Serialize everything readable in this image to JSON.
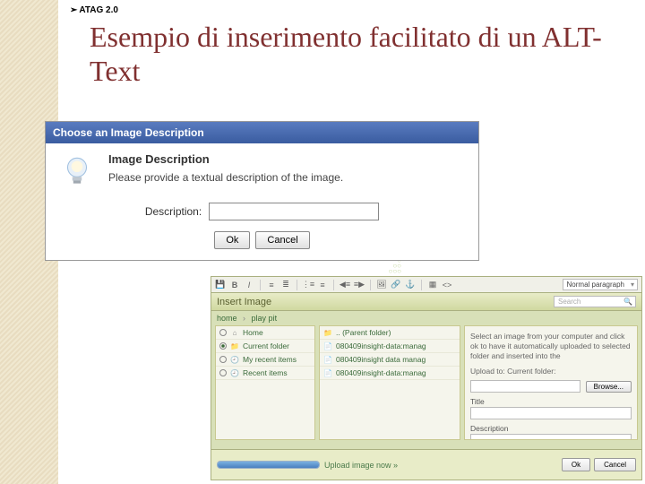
{
  "tag": "ATAG 2.0",
  "title": "Esempio di inserimento facilitato di un ALT-Text",
  "dialog1": {
    "title": "Choose an Image Description",
    "heading": "Image Description",
    "prompt": "Please provide a textual description of the image.",
    "label": "Description:",
    "ok": "Ok",
    "cancel": "Cancel"
  },
  "dialog2": {
    "toolbar_select": "Normal paragraph",
    "panel_title": "Insert Image",
    "search_placeholder": "Search",
    "breadcrumbs": [
      "home",
      "play pit"
    ],
    "nav": [
      {
        "label": "Home",
        "kind": "home"
      },
      {
        "label": "Current folder",
        "kind": "folder",
        "active": true
      },
      {
        "label": "My recent items",
        "kind": "recent"
      },
      {
        "label": "Recent items",
        "kind": "recent"
      }
    ],
    "files": [
      {
        "label": ".. (Parent folder)",
        "kind": "up"
      },
      {
        "label": "080409insight-data:manag",
        "kind": "file"
      },
      {
        "label": "080409insight data manag",
        "kind": "file"
      },
      {
        "label": "080409insight-data:manag",
        "kind": "file"
      }
    ],
    "help_text": "Select an image from your computer and click ok to have it automatically uploaded to selected folder and inserted into the",
    "upload_label": "Upload to: Current folder:",
    "browse": "Browse...",
    "title_label": "Title",
    "desc_label": "Description",
    "upload_caption": "Upload image now »",
    "btn_ok": "Ok",
    "btn_cancel": "Cancel"
  }
}
